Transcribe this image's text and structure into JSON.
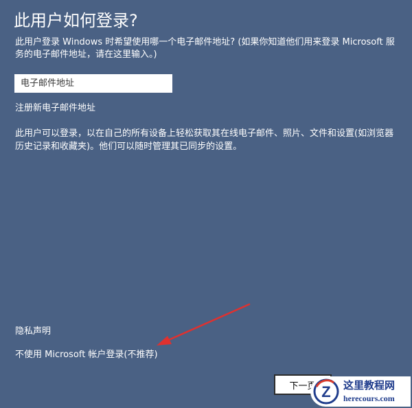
{
  "page": {
    "title": "此用户如何登录?",
    "description": "此用户登录 Windows 时希望使用哪一个电子邮件地址? (如果你知道他们用来登录 Microsoft 服务的电子邮件地址，请在这里输入。)",
    "email": {
      "placeholder": "电子邮件地址",
      "value": ""
    },
    "register_link": "注册新电子邮件地址",
    "info_text": "此用户可以登录，以在自己的所有设备上轻松获取其在线电子邮件、照片、文件和设置(如浏览器历史记录和收藏夹)。他们可以随时管理其已同步的设置。",
    "privacy_link": "隐私声明",
    "local_account_link": "不使用 Microsoft 帐户登录(不推荐)",
    "next_button": "下一页"
  },
  "annotation": {
    "arrow_color": "#e0312f"
  },
  "watermark": {
    "site_name": "这里教程网",
    "url": "herecours.com",
    "logo_letter": "Z"
  },
  "colors": {
    "background": "#4a6184",
    "text": "#ffffff"
  }
}
